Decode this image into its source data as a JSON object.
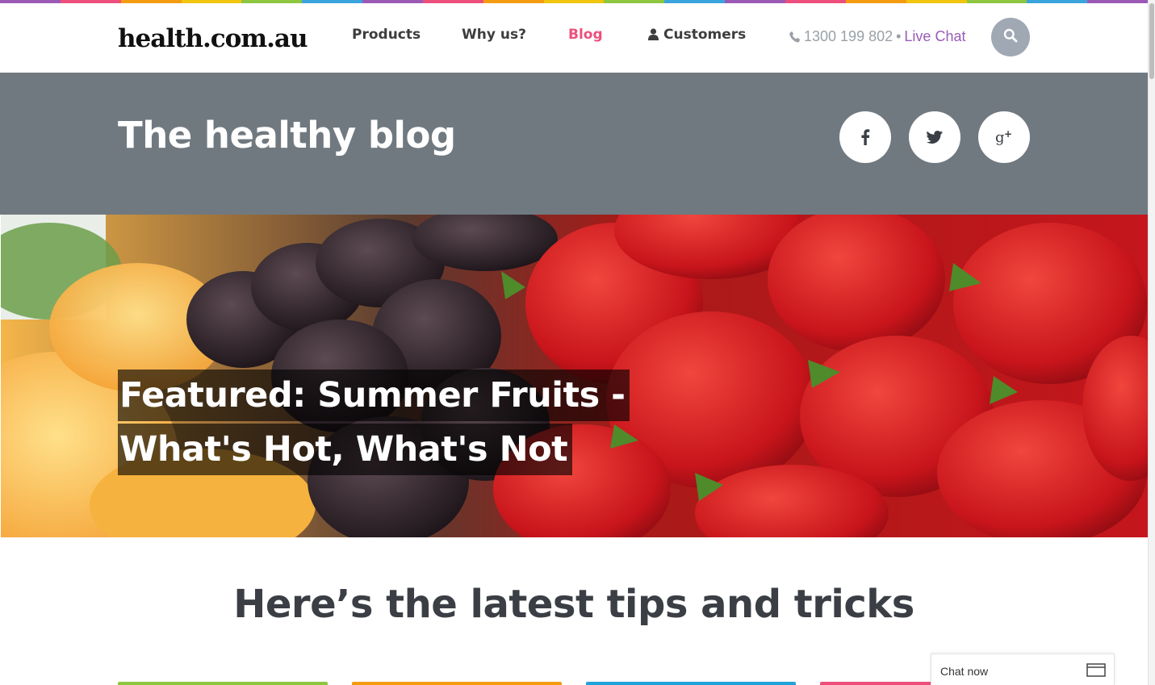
{
  "colors": {
    "stripe": [
      "#9b59b6",
      "#ec4f7c",
      "#f39c12",
      "#f1c40f",
      "#8dc63f",
      "#3aa5dc",
      "#9b59b6",
      "#ec4f7c",
      "#f39c12",
      "#f1c40f",
      "#8dc63f",
      "#3aa5dc",
      "#9b59b6",
      "#ec4f7c",
      "#f39c12",
      "#f1c40f",
      "#8dc63f",
      "#3aa5dc",
      "#9b59b6"
    ],
    "accent": "#ec4f7c",
    "live_chat": "#9a5bb5",
    "banner": "#717980",
    "card_tops": [
      "#8dc63f",
      "#f39c12",
      "#1fa3d8",
      "#ec4f7c"
    ]
  },
  "header": {
    "logo": "health.com.au",
    "nav": [
      {
        "label": "Products",
        "active": false
      },
      {
        "label": "Why us?",
        "active": false
      },
      {
        "label": "Blog",
        "active": true
      },
      {
        "label": "Customers",
        "active": false,
        "icon": "user-icon"
      }
    ],
    "phone": "1300 199 802",
    "separator": "•",
    "live_chat": "Live Chat",
    "search_icon": "search-icon"
  },
  "banner": {
    "title": "The healthy blog",
    "social": [
      "facebook-icon",
      "twitter-icon",
      "google-plus-icon"
    ]
  },
  "hero": {
    "featured_line1": "Featured: Summer Fruits -",
    "featured_line2": "What's Hot, What's Not"
  },
  "tips": {
    "title": "Here’s the latest tips and tricks"
  },
  "chat_widget": {
    "label": "Chat now",
    "icon": "window-icon"
  }
}
